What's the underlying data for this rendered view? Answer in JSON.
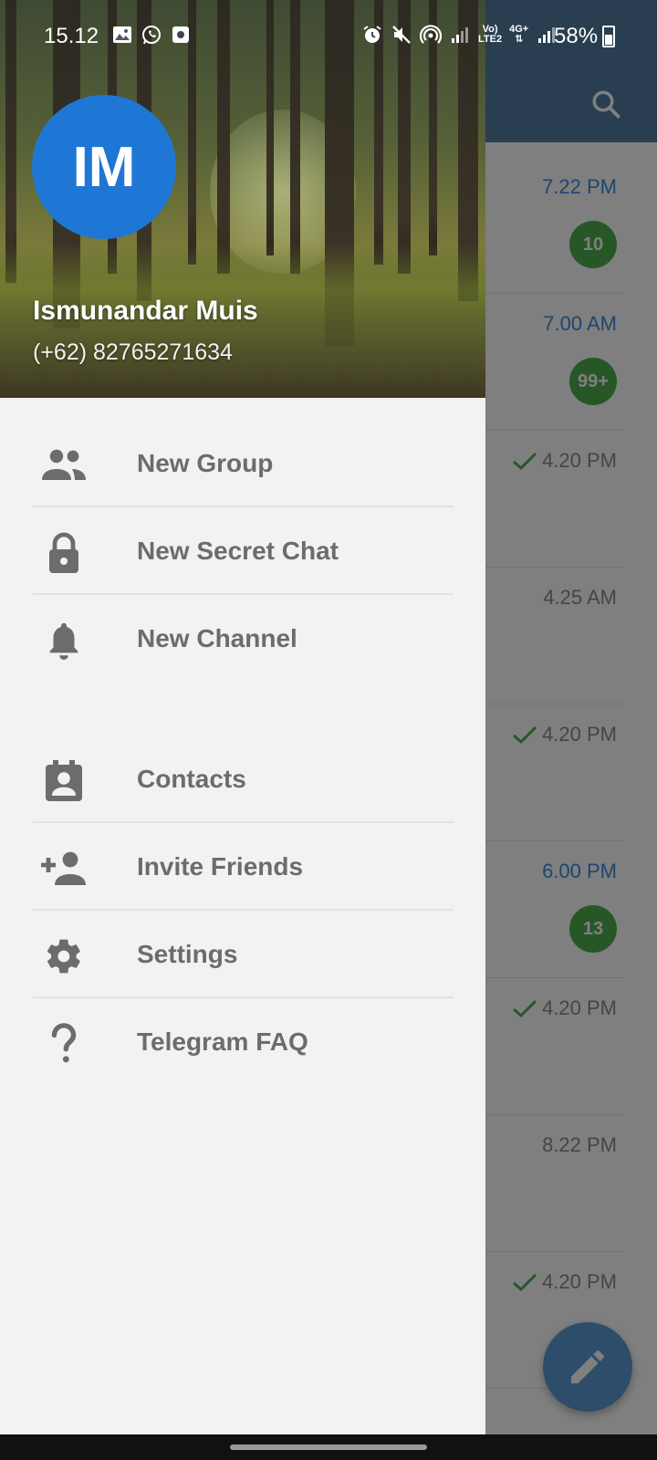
{
  "status_bar": {
    "time": "15.12",
    "battery": "58%",
    "net_top": "Vo)",
    "net_bottom": "LTE2",
    "net_4g": "4G+"
  },
  "colors": {
    "drawer_bg": "#f2f2f2",
    "avatar": "#1e77d4",
    "toolbar": "#527da3",
    "badge": "#4fae4e",
    "menu_text": "#6c6c6c"
  },
  "drawer": {
    "avatar_initials": "IM",
    "user_name": "Ismunandar Muis",
    "user_phone": "(+62) 82765271634",
    "menu": [
      {
        "label": "New Group",
        "icon": "group-icon"
      },
      {
        "label": "New Secret Chat",
        "icon": "lock-icon"
      },
      {
        "label": "New Channel",
        "icon": "bell-icon"
      },
      {
        "label": "Contacts",
        "icon": "contacts-icon"
      },
      {
        "label": "Invite Friends",
        "icon": "add-person-icon"
      },
      {
        "label": "Settings",
        "icon": "gear-icon"
      },
      {
        "label": "Telegram FAQ",
        "icon": "question-icon"
      }
    ]
  },
  "chat_list": {
    "rows": [
      {
        "time": "7.22 PM",
        "badge": "10",
        "read": false
      },
      {
        "time": "7.00 AM",
        "badge": "99+",
        "read": false
      },
      {
        "time": "4.20 PM",
        "badge": "",
        "read": true
      },
      {
        "time": "4.25 AM",
        "badge": "",
        "read": false
      },
      {
        "time": "4.20 PM",
        "badge": "",
        "read": true
      },
      {
        "time": "6.00 PM",
        "badge": "13",
        "read": false
      },
      {
        "time": "4.20 PM",
        "badge": "",
        "read": true
      },
      {
        "time": "8.22 PM",
        "badge": "",
        "read": false
      },
      {
        "time": "4.20 PM",
        "badge": "",
        "read": true
      }
    ]
  }
}
